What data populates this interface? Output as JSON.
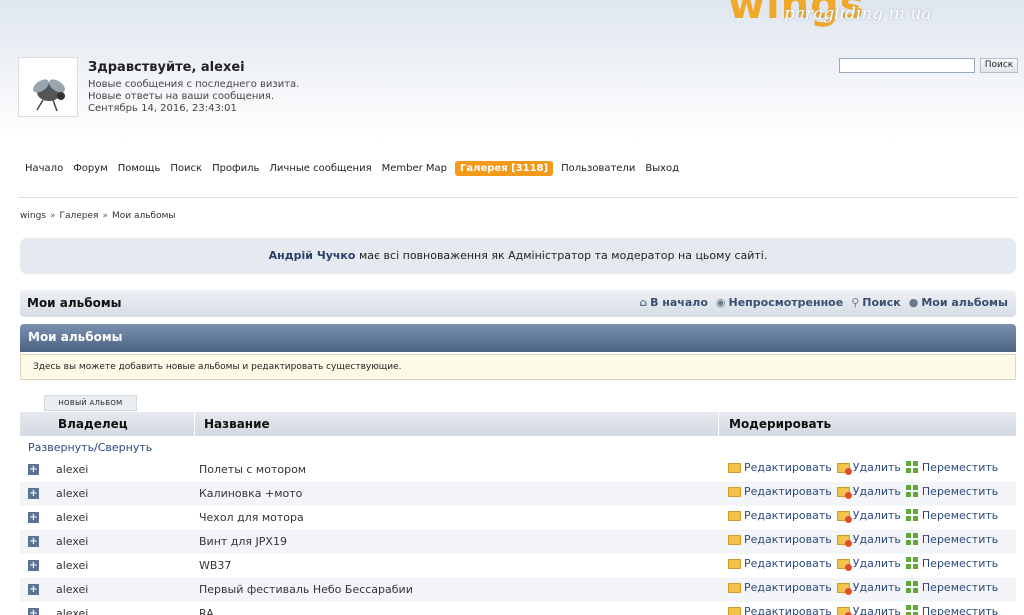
{
  "logo": {
    "text": "wings",
    "tagline": "paragliding in ua"
  },
  "user": {
    "greeting": "Здравствуйте, alexei",
    "new_messages": "Новые сообщения с последнего визита.",
    "new_replies": "Новые ответы на ваши сообщения.",
    "datetime": "Сентябрь 14, 2016, 23:43:01"
  },
  "search": {
    "button_label": "Поиск",
    "value": ""
  },
  "nav": {
    "items": [
      "Начало",
      "Форум",
      "Помощь",
      "Поиск",
      "Профиль",
      "Личные сообщения",
      "Member Map"
    ],
    "active": "Галерея [3118]",
    "after": [
      "Пользователи",
      "Выход"
    ]
  },
  "breadcrumb": [
    "wings",
    "Галерея",
    "Мои альбомы"
  ],
  "notice": {
    "name": "Андрій Чучко",
    "text": " має всі повноваження як Адміністратор та модератор на цьому сайті."
  },
  "section": {
    "title": "Мои альбомы",
    "links": [
      "В начало",
      "Непросмотренное",
      "Поиск",
      "Мои альбомы"
    ],
    "header": "Мои альбомы",
    "description": "Здесь вы можете добавить новые альбомы и редактировать существующие.",
    "new_album_button": "НОВЫЙ АЛЬБОМ"
  },
  "table": {
    "columns": [
      "Владелец",
      "Название",
      "Модерировать"
    ],
    "expand_label": "Развернуть/Свернуть",
    "actions": [
      "Редактировать",
      "Удалить",
      "Переместить"
    ],
    "rows": [
      {
        "owner": "alexei",
        "name": "Полеты с мотором"
      },
      {
        "owner": "alexei",
        "name": "Калиновка +мото"
      },
      {
        "owner": "alexei",
        "name": "Чехол для мотора"
      },
      {
        "owner": "alexei",
        "name": "Винт для JPX19"
      },
      {
        "owner": "alexei",
        "name": "WB37"
      },
      {
        "owner": "alexei",
        "name": "Первый фестиваль Небо Бессарабии"
      },
      {
        "owner": "alexei",
        "name": "RA"
      }
    ]
  },
  "colors": {
    "accent": "#f49a1a",
    "header_blue": "#4d6384",
    "link": "#2a4a7a"
  }
}
